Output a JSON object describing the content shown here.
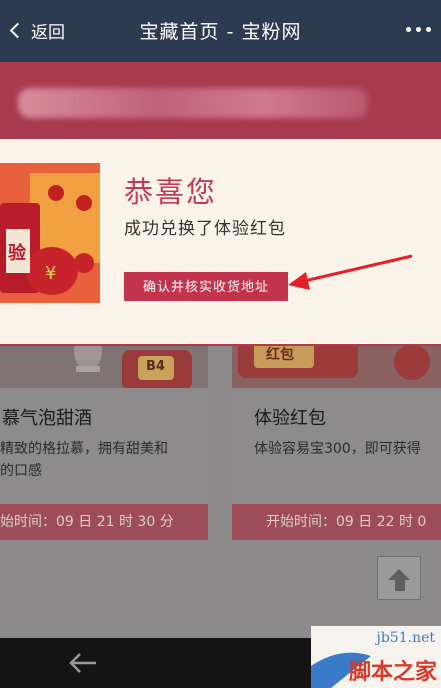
{
  "navbar": {
    "back_label": "返回",
    "title": "宝藏首页 - 宝粉网"
  },
  "modal": {
    "title": "恭喜您",
    "subtitle": "成功兑换了体验红包",
    "confirm_label": "确认并核实收货地址",
    "gift_image_text": "验"
  },
  "cards": [
    {
      "badge": "B4",
      "title": "慕气泡甜酒",
      "desc_line1": "精致的格拉慕，拥有甜美和",
      "desc_line2": "的口感",
      "time": "始时间：09 日 21 时 30 分"
    },
    {
      "badge": "红包",
      "title": "体验红包",
      "desc_line1": "体验容易宝300，即可获得",
      "desc_line2": "",
      "time": "开始时间：09 日 22 时 0"
    }
  ],
  "watermark": {
    "url": "jb51.net",
    "name": "脚本之家"
  },
  "colors": {
    "navbar": "#2c3a52",
    "accent": "#c23b52",
    "modal_bg": "#faf3ea"
  }
}
